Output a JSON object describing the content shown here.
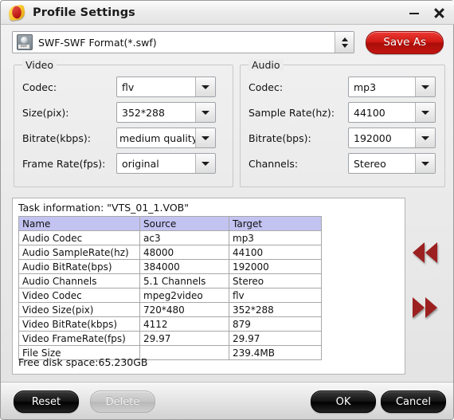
{
  "window": {
    "title": "Profile Settings",
    "app_icon": "profile-settings-icon",
    "minimize_label": "–",
    "close_label": "✕"
  },
  "format_row": {
    "icon": "swf-file-icon",
    "icon_tag": "SWF",
    "selected_format": "SWF-SWF Format(*.swf)",
    "spinner": "spinner-updown-icon",
    "save_as_label": "Save As",
    "save_as_color": "#c31510"
  },
  "video": {
    "legend": "Video",
    "fields": [
      {
        "label": "Codec:",
        "value": "flv"
      },
      {
        "label": "Size(pix):",
        "value": "352*288"
      },
      {
        "label": "Bitrate(kbps):",
        "value": "medium quality"
      },
      {
        "label": "Frame Rate(fps):",
        "value": "original"
      }
    ]
  },
  "audio": {
    "legend": "Audio",
    "fields": [
      {
        "label": "Codec:",
        "value": "mp3"
      },
      {
        "label": "Sample Rate(hz):",
        "value": "44100"
      },
      {
        "label": "Bitrate(bps):",
        "value": "192000"
      },
      {
        "label": "Channels:",
        "value": "Stereo"
      }
    ]
  },
  "task_info": {
    "title": "Task information: \"VTS_01_1.VOB\"",
    "columns": [
      "Name",
      "Source",
      "Target"
    ],
    "header_color": "#c3c3f2",
    "rows": [
      [
        "Audio Codec",
        "ac3",
        "mp3"
      ],
      [
        "Audio SampleRate(hz)",
        "48000",
        "44100"
      ],
      [
        "Audio BitRate(bps)",
        "384000",
        "192000"
      ],
      [
        "Audio Channels",
        "5.1 Channels",
        "Stereo"
      ],
      [
        "Video Codec",
        "mpeg2video",
        "flv"
      ],
      [
        "Video Size(pix)",
        "720*480",
        "352*288"
      ],
      [
        "Video BitRate(kbps)",
        "4112",
        "879"
      ],
      [
        "Video FrameRate(fps)",
        "29.97",
        "29.97"
      ],
      [
        "File Size",
        "",
        "239.4MB"
      ]
    ],
    "free_space": "Free disk space:65.230GB"
  },
  "nav": {
    "prev_icon": "double-arrow-left-icon",
    "next_icon": "double-arrow-right-icon",
    "arrow_color": "#9c2020"
  },
  "footer": {
    "reset_label": "Reset",
    "delete_label": "Delete",
    "ok_label": "OK",
    "cancel_label": "Cancel"
  }
}
